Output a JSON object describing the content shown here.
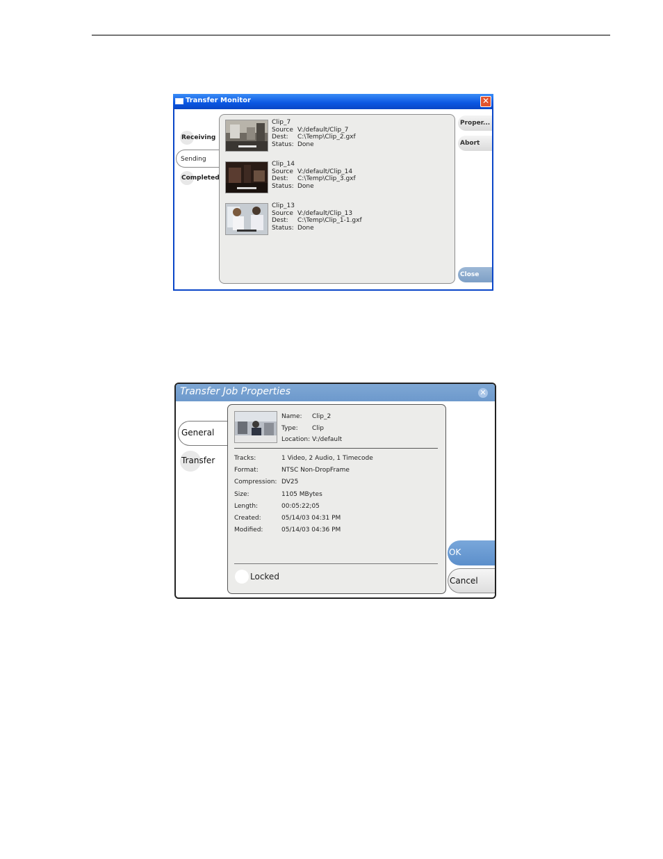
{
  "transfer_monitor": {
    "title": "Transfer Monitor",
    "tabs": [
      "Receiving",
      "Sending",
      "Completed"
    ],
    "active_tab": "Sending",
    "clips": [
      {
        "name": "Clip_7",
        "source_label": "Source",
        "source": "V:/default/Clip_7",
        "dest_label": "Dest:",
        "dest": "C:\\Temp\\Clip_2.gxf",
        "status_label": "Status:",
        "status": "Done"
      },
      {
        "name": "Clip_14",
        "source_label": "Source",
        "source": "V:/default/Clip_14",
        "dest_label": "Dest:",
        "dest": "C:\\Temp\\Clip_3.gxf",
        "status_label": "Status:",
        "status": "Done"
      },
      {
        "name": "Clip_13",
        "source_label": "Source",
        "source": "V:/default/Clip_13",
        "dest_label": "Dest:",
        "dest": "C:\\Temp\\Clip_1-1.gxf",
        "status_label": "Status:",
        "status": "Done"
      }
    ],
    "buttons": {
      "properties": "Proper...",
      "abort": "Abort",
      "close": "Close"
    },
    "colors": {
      "titlebar": "#0a56e2",
      "panel": "#ececea",
      "close_button": "#7d9fc6"
    }
  },
  "transfer_job_properties": {
    "title": "Transfer Job Properties",
    "tabs": [
      "General",
      "Transfer"
    ],
    "active_tab": "General",
    "header": {
      "name_label": "Name:",
      "name": "Clip_2",
      "type_label": "Type:",
      "type": "Clip",
      "location_label": "Location:",
      "location": "V:/default"
    },
    "fields": [
      {
        "label": "Tracks:",
        "value": "1 Video, 2 Audio, 1 Timecode"
      },
      {
        "label": "Format:",
        "value": "NTSC Non-DropFrame"
      },
      {
        "label": "Compression:",
        "value": "DV25"
      },
      {
        "label": "Size:",
        "value": "1105 MBytes"
      },
      {
        "label": "Length:",
        "value": "00:05:22;05"
      },
      {
        "label": "Created:",
        "value": "05/14/03 04:31 PM"
      },
      {
        "label": "Modified:",
        "value": "05/14/03 04:36 PM"
      }
    ],
    "locked_label": "Locked",
    "buttons": {
      "ok": "OK",
      "cancel": "Cancel"
    },
    "colors": {
      "titlebar": "#6d99cc",
      "ok_button": "#5c8fcb",
      "panel": "#ececea"
    }
  }
}
